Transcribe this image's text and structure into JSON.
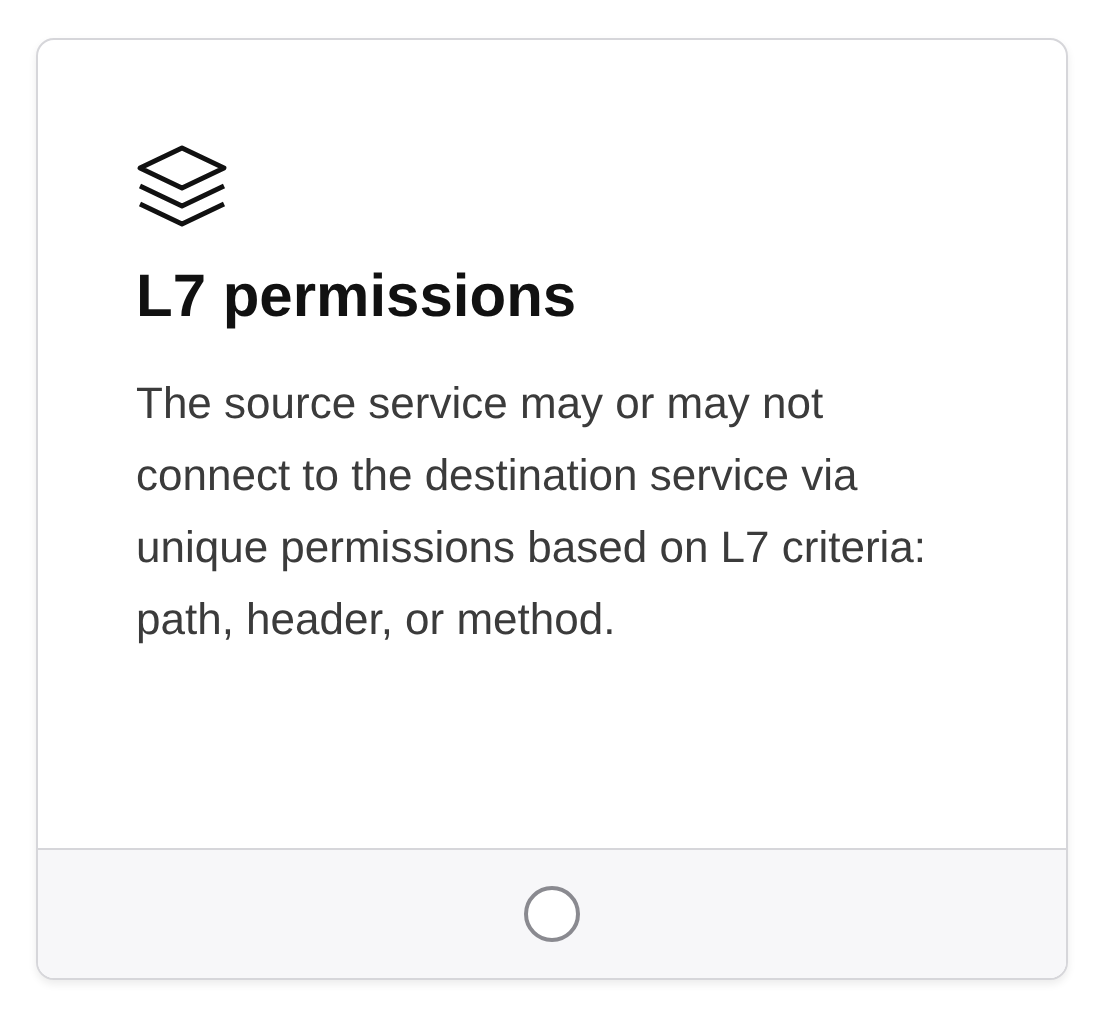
{
  "card": {
    "title": "L7 permissions",
    "description": "The source service may or may not connect to the destination service via unique permissions based on L7 criteria: path, header, or method.",
    "radio": {
      "selected": false
    }
  }
}
